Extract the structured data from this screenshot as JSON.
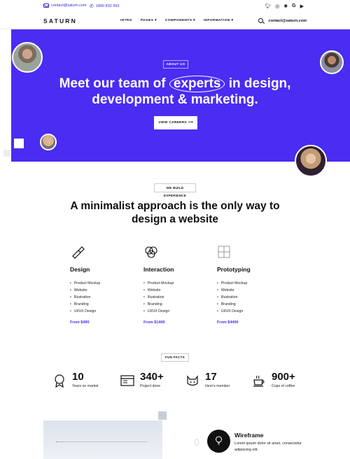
{
  "topbar": {
    "email": "contact@saturn.com",
    "phone": "1800 832 993",
    "social": [
      "twitter-icon",
      "instagram-icon",
      "dribbble-icon",
      "google-icon",
      "youtube-icon"
    ]
  },
  "nav": {
    "logo": "SATURN",
    "items": [
      "INTRO",
      "PAGES ▾",
      "COMPONENTS ▾",
      "INFORMATION ▾"
    ],
    "contact": "contact@saturn.com"
  },
  "hero": {
    "badge": "ABOUT US",
    "title_pre": "Meet our team of ",
    "title_highlight": "experts",
    "title_post": " in design, development & marketing.",
    "button": "VIEW CAREERS  ⟶",
    "accent": "#4a2cf2"
  },
  "experience": {
    "badge": "WE BUILD EXPERIENCE",
    "title": "A minimalist approach is the only way to design a website",
    "columns": [
      {
        "title": "Design",
        "items": [
          "Product Mockup",
          "Website",
          "Illustration",
          "Branding",
          "UI/UX Design"
        ],
        "price": "From $490",
        "icon": "paintbrush-icon"
      },
      {
        "title": "Interaction",
        "items": [
          "Product Mockup",
          "Website",
          "Illustration",
          "Branding",
          "UI/UX Design"
        ],
        "price": "From $1400",
        "icon": "circles-icon"
      },
      {
        "title": "Prototyping",
        "items": [
          "Product Mockup",
          "Website",
          "Illustration",
          "Branding",
          "UI/UX Design"
        ],
        "price": "From $4400",
        "icon": "grid-icon"
      }
    ]
  },
  "facts": {
    "badge": "FUN FACTS",
    "items": [
      {
        "num": "10",
        "label": "Years on market",
        "icon": "award-icon"
      },
      {
        "num": "340+",
        "label": "Project done",
        "icon": "browser-icon"
      },
      {
        "num": "17",
        "label": "Hero's member",
        "icon": "cat-icon"
      },
      {
        "num": "900+",
        "label": "Cups of coffee",
        "icon": "coffee-icon"
      }
    ]
  },
  "wireframe": {
    "title": "Wireframe",
    "text": "Lorem ipsum dolor sit amet, consectetur adipiscing elit."
  }
}
